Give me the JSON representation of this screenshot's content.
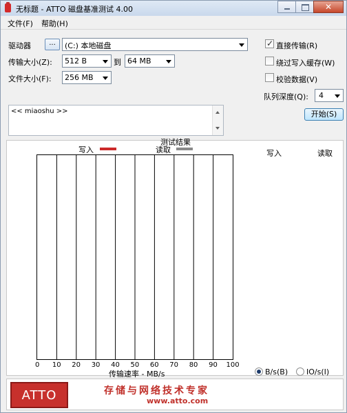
{
  "window": {
    "title": "无标题 - ATTO 磁盘基准测试 4.00",
    "close_glyph": "✕"
  },
  "menu": [
    "文件(F)",
    "帮助(H)"
  ],
  "drive": {
    "label": "驱动器",
    "browse_label": "...",
    "value": "(C:) 本地磁盘"
  },
  "transfer_size": {
    "label": "传输大小(Z):",
    "from": "512 B",
    "to_label": "到",
    "to": "64 MB"
  },
  "file_size": {
    "label": "文件大小(F):",
    "value": "256 MB"
  },
  "options": {
    "direct_io": {
      "label": "直接传输(R)",
      "checked": true
    },
    "bypass_write_cache": {
      "label": "绕过写入缓存(W)",
      "checked": false
    },
    "verify_data": {
      "label": "校验数据(V)",
      "checked": false
    },
    "queue_depth_label": "队列深度(Q):",
    "queue_depth": "4",
    "check_glyph": "✓"
  },
  "start_button": "开始(S)",
  "description": "<< miaoshu >>",
  "results": {
    "title": "测试结果",
    "legend_write": "写入",
    "legend_read": "读取",
    "col_write": "写入",
    "col_read": "读取",
    "write_color": "#cc2a2a",
    "read_color": "#8a8a8a"
  },
  "chart_data": {
    "type": "bar",
    "title": "测试结果",
    "xlabel": "传输速率 - MB/s",
    "ylabel": "",
    "xlim": [
      0,
      100
    ],
    "x_ticks": [
      "0",
      "10",
      "20",
      "30",
      "40",
      "50",
      "60",
      "70",
      "80",
      "90",
      "100"
    ],
    "series": [
      {
        "name": "写入",
        "values": []
      },
      {
        "name": "读取",
        "values": []
      }
    ],
    "grid": "vertical"
  },
  "units": {
    "bytes_label": "B/s(B)",
    "io_label": "IO/s(I)",
    "selected": "bytes"
  },
  "banner": {
    "logo": "ATTO",
    "slogan": "存储与网络技术专家",
    "site": "www.atto.com"
  }
}
